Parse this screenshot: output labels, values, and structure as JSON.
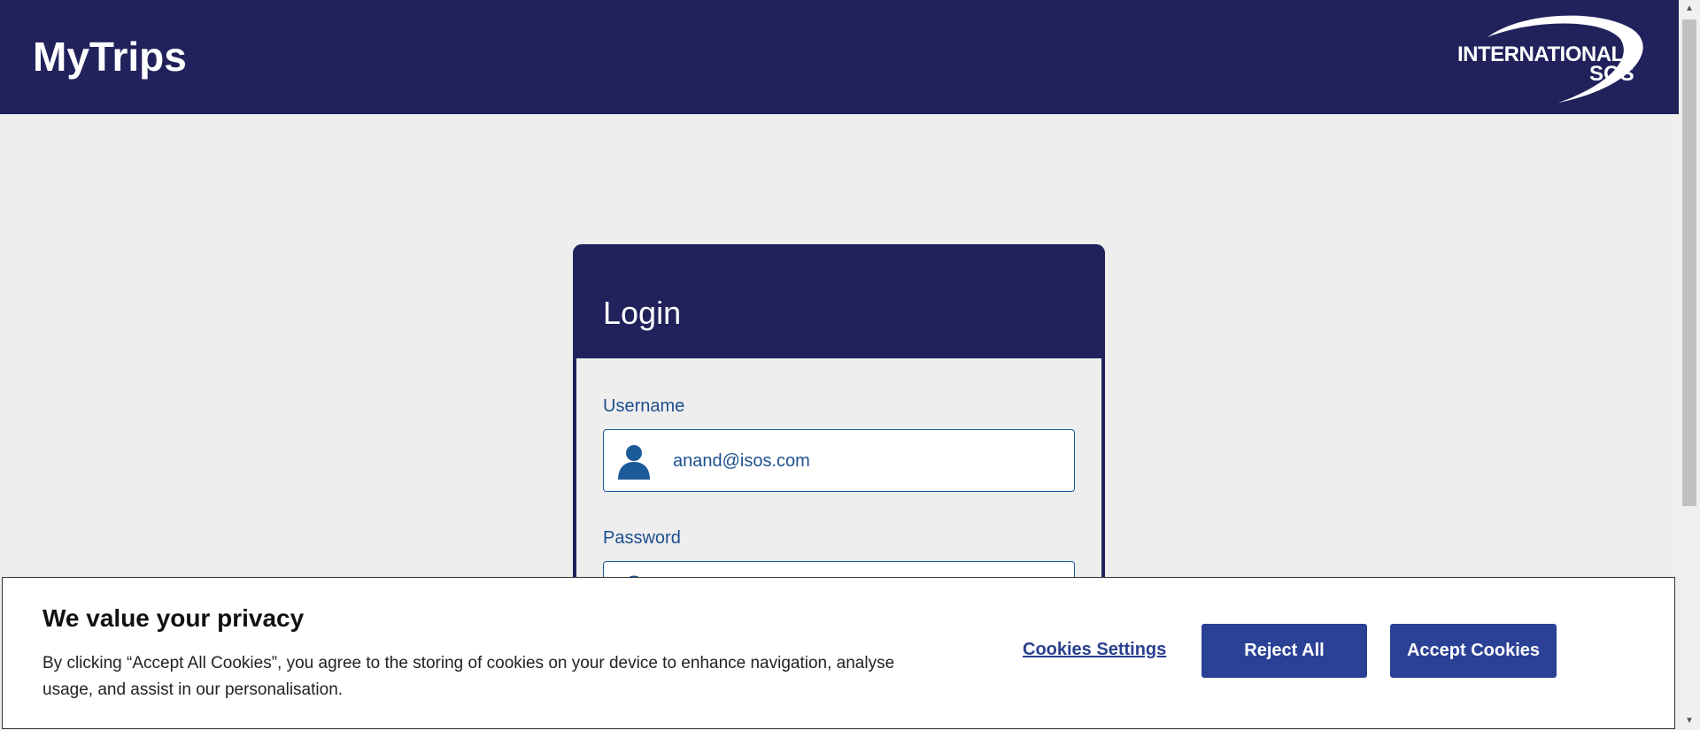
{
  "header": {
    "title": "MyTrips",
    "logo_line1": "INTERNATIONAL",
    "logo_line2": "SOS"
  },
  "login": {
    "title": "Login",
    "username_label": "Username",
    "username_value": "anand@isos.com",
    "password_label": "Password",
    "password_value": "",
    "user_icon": "user-icon",
    "lock_icon": "lock-icon"
  },
  "cookie_banner": {
    "title": "We value your privacy",
    "text": "By clicking “Accept All Cookies”, you agree to the storing of cookies on your device to enhance navigation, analyse usage, and assist in our personalisation.",
    "settings_label": "Cookies Settings",
    "reject_label": "Reject All",
    "accept_label": "Accept Cookies"
  },
  "colors": {
    "navy": "#21225c",
    "field_blue": "#1d4f8f",
    "button_blue": "#2b4196",
    "background": "#eeeeee"
  }
}
